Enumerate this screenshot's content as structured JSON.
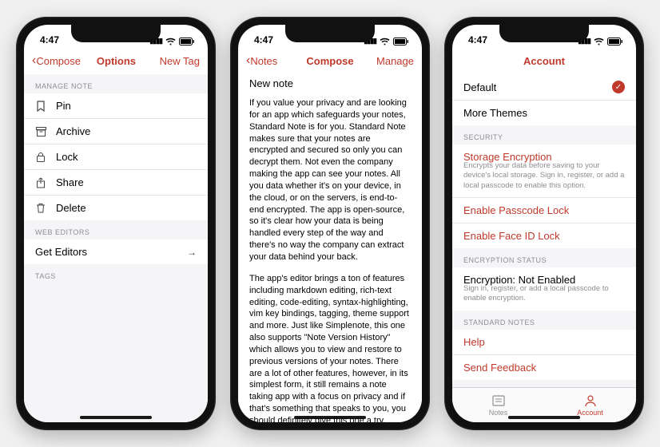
{
  "status": {
    "time": "4:47"
  },
  "phone1": {
    "nav": {
      "back": "Compose",
      "title": "Options",
      "right": "New Tag"
    },
    "sections": {
      "manage_note": "MANAGE NOTE",
      "web_editors": "WEB EDITORS",
      "tags": "TAGS"
    },
    "items": {
      "pin": "Pin",
      "archive": "Archive",
      "lock": "Lock",
      "share": "Share",
      "delete": "Delete",
      "get_editors": "Get Editors"
    }
  },
  "phone2": {
    "nav": {
      "back": "Notes",
      "title": "Compose",
      "right": "Manage"
    },
    "note_title": "New note",
    "para1": "If you value your privacy and are looking for an app which safeguards your notes, Standard Note is for you. Standard Note makes sure that your notes are encrypted and secured so only you can decrypt them. Not even the company making the app can see your notes. All you data whether it's on your device, in the cloud, or on the servers, is end-to-end encrypted. The app is open-source, so it's clear how your data is being handled every step of the way and there's no way the company can extract your data behind your back.",
    "para2": "The app's editor brings a ton of features including markdown editing, rich-text editing, code-editing, syntax-highlighting, vim key bindings, tagging, theme support and more. Just like Simplenote, this one also supports \"Note Version History\" which allows you to view and restore to previous versions of your notes. There are a lot of other features, however, in its simplest form, it still remains a note taking app with a focus on privacy and if that's something that speaks to you, you should definitely give this one a try."
  },
  "phone3": {
    "nav": {
      "title": "Account"
    },
    "items": {
      "default": "Default",
      "more_themes": "More Themes"
    },
    "sections": {
      "security": "SECURITY",
      "encryption_status": "ENCRYPTION STATUS",
      "standard_notes": "STANDARD NOTES"
    },
    "security": {
      "storage_encryption": "Storage Encryption",
      "storage_encryption_sub": "Encrypts your data before saving to your device's local storage. Sign in, register, or add a local passcode to enable this option.",
      "passcode": "Enable Passcode Lock",
      "faceid": "Enable Face ID Lock"
    },
    "encryption": {
      "status": "Encryption: Not Enabled",
      "sub": "Sign in, register, or add a local passcode to enable encryption."
    },
    "standard": {
      "help": "Help",
      "feedback": "Send Feedback"
    },
    "tabs": {
      "notes": "Notes",
      "account": "Account"
    }
  }
}
